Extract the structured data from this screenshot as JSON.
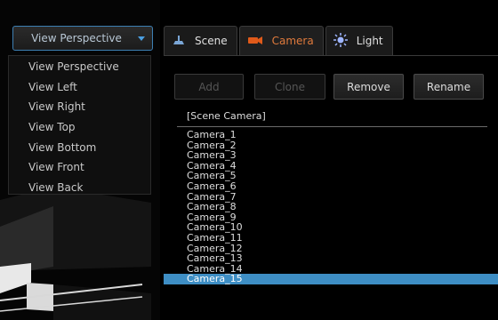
{
  "view_selector": {
    "value": "View Perspective"
  },
  "view_menu": [
    "View Perspective",
    "View Left",
    "View Right",
    "View Top",
    "View Bottom",
    "View Front",
    "View Back"
  ],
  "tabs": [
    {
      "label": "Scene",
      "icon": "scene-icon",
      "color": "#7aa6d6"
    },
    {
      "label": "Camera",
      "icon": "camera-icon",
      "color": "#e05a1a",
      "active": true
    },
    {
      "label": "Light",
      "icon": "light-icon",
      "color": "#9fb6ff"
    }
  ],
  "buttons": {
    "add": "Add",
    "clone": "Clone",
    "remove": "Remove",
    "rename": "Rename"
  },
  "camera_list": {
    "header": "[Scene Camera]",
    "items": [
      "Camera_1",
      "Camera_2",
      "Camera_3",
      "Camera_4",
      "Camera_5",
      "Camera_6",
      "Camera_7",
      "Camera_8",
      "Camera_9",
      "Camera_10",
      "Camera_11",
      "Camera_12",
      "Camera_13",
      "Camera_14",
      "Camera_15"
    ],
    "selected": "Camera_15"
  },
  "colors": {
    "accent": "#3e8ec4",
    "camera_tab": "#e07a3c"
  }
}
